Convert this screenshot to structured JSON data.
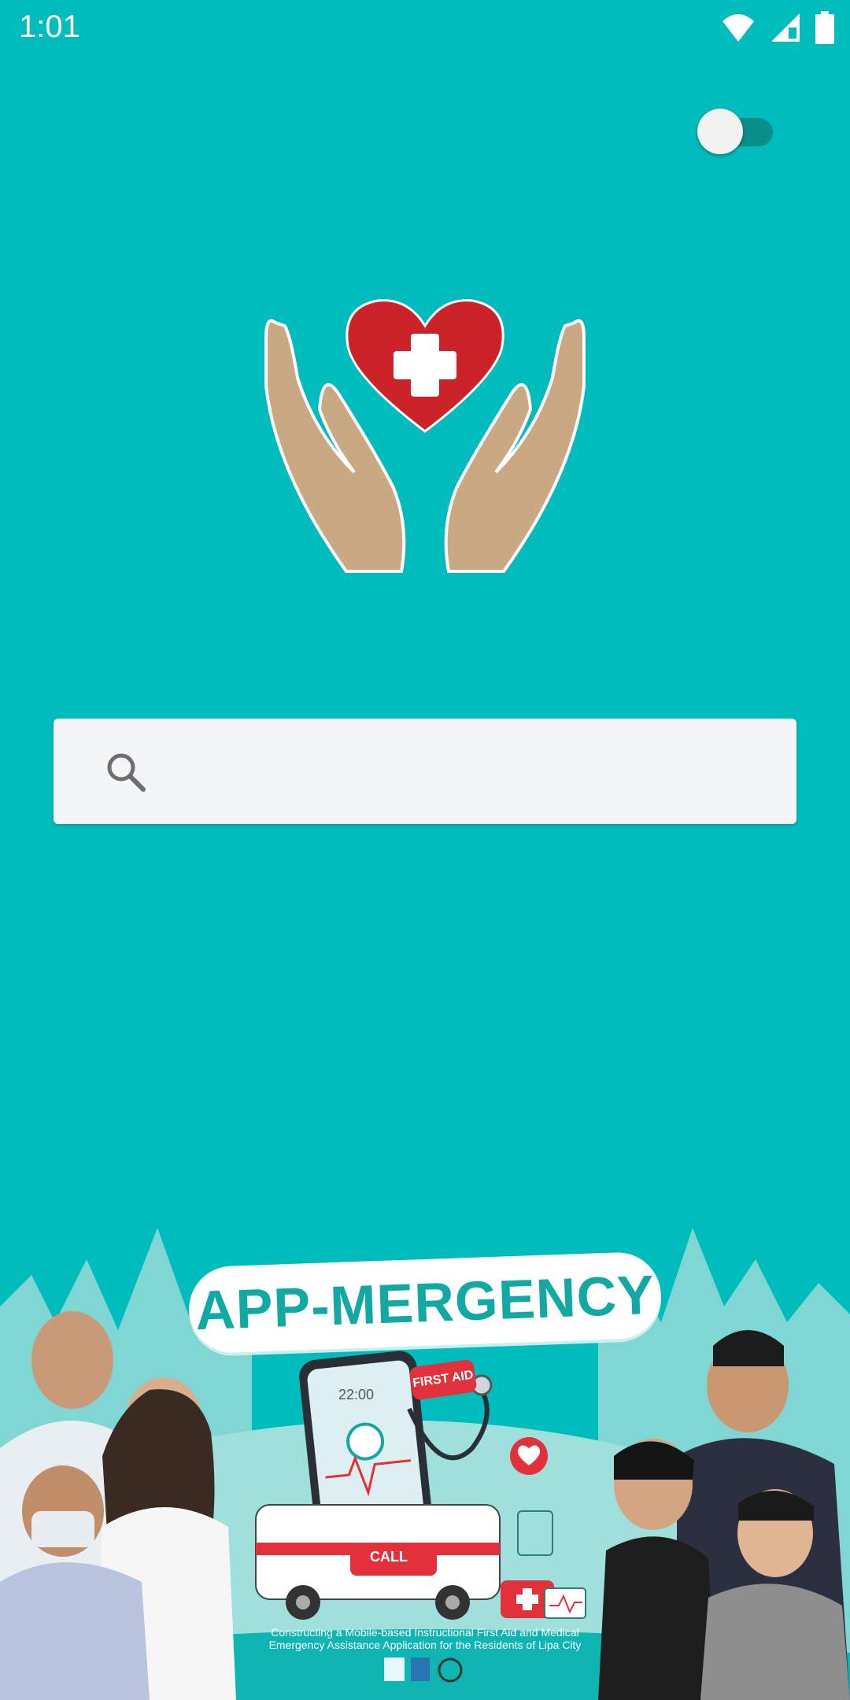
{
  "status_bar": {
    "time": "1:01",
    "icons": [
      "wifi-icon",
      "cellular-signal-icon",
      "battery-icon"
    ]
  },
  "toggle": {
    "state": "off"
  },
  "logo": {
    "icon": "hands-heart-cross-icon"
  },
  "search": {
    "placeholder": "",
    "value": "",
    "icon": "search-icon"
  },
  "banner": {
    "title": "APP-MERGENCY",
    "first_aid": "FIRST AID",
    "phone_time": "22:00",
    "call": "CALL",
    "caption": "Constructing a Mobile-based Instructional First Aid and Medical Emergency Assistance Application for the Residents of Lipa City"
  },
  "colors": {
    "background": "#00BCBC",
    "search_bg": "#F4F5F7",
    "heart_red": "#CC2229",
    "hands_tan": "#C9A884",
    "toggle_track": "#0A8E8A"
  }
}
